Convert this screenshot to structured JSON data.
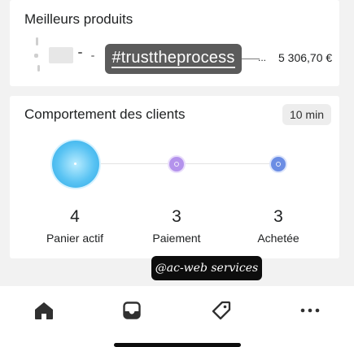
{
  "top_products": {
    "title": "Meilleurs produits",
    "tag": "#trusttheprocess",
    "ellipsis": "...",
    "amount": "5 306,70 €"
  },
  "behavior": {
    "title": "Comportement des clients",
    "time_badge": "10 min",
    "stages": [
      {
        "count": "4",
        "label": "Panier actif"
      },
      {
        "count": "3",
        "label": "Paiement"
      },
      {
        "count": "3",
        "label": "Achetée"
      }
    ]
  },
  "watermark": "@ac-web services",
  "tabbar": {
    "icons": [
      "home-icon",
      "inbox-icon",
      "tag-icon",
      "more-icon"
    ]
  },
  "colors": {
    "cart_node": "#59c3f3",
    "payment_node": "#b493ec",
    "purchased_node": "#6b8de4",
    "tab_icon": "#303030"
  }
}
